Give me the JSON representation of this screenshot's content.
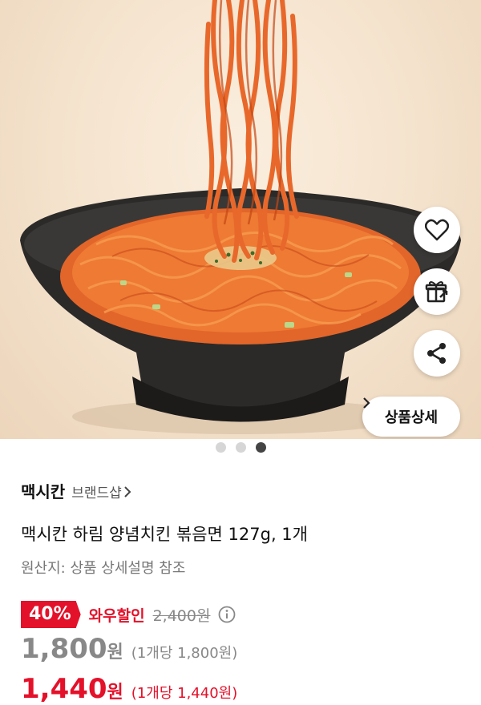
{
  "product_image": {
    "alt": "매콤한 볶음면이 담긴 검은 그릇"
  },
  "actions": {
    "like_icon": "heart-icon",
    "gift_icon": "gift-icon",
    "share_icon": "share-icon",
    "detail_label": "상품상세"
  },
  "carousel": {
    "total": 3,
    "active_index": 2
  },
  "brand": {
    "name": "맥시칸",
    "shop_label": "브랜드샵"
  },
  "product": {
    "title": "맥시칸 하림 양념치킨 볶음면 127g, 1개",
    "origin": "원산지: 상품 상세설명 참조"
  },
  "pricing": {
    "discount_rate": "40%",
    "discount_label": "와우할인",
    "original_price": "2,400원",
    "sale_price": "1,800",
    "sale_currency": "원",
    "sale_unit": "(1개당 1,800원)",
    "coupon_price": "1,440",
    "coupon_currency": "원",
    "coupon_unit": "(1개당 1,440원)"
  },
  "colors": {
    "accent": "#e4112a",
    "muted": "#888888"
  }
}
